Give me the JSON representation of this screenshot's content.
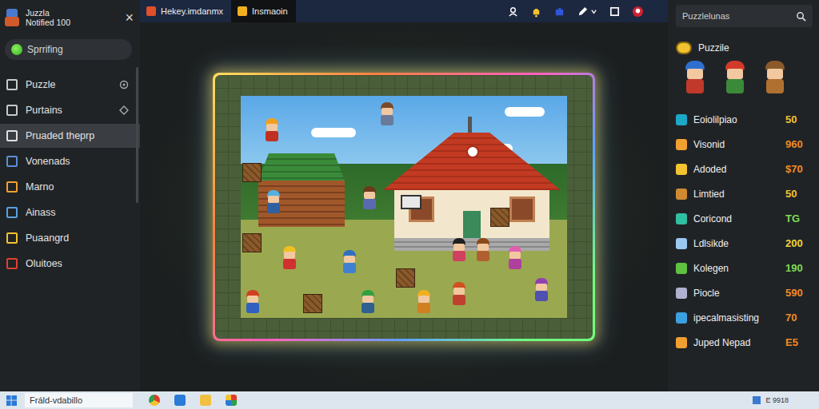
{
  "window": {
    "app_name": "Juzzla",
    "subtitle": "Notified 100",
    "close": "×"
  },
  "sidebar": {
    "search": "Sprrifing",
    "items": [
      {
        "label": "Puzzle",
        "selected": false
      },
      {
        "label": "Purtains",
        "selected": false
      },
      {
        "label": "Pruaded theprp",
        "selected": true
      },
      {
        "label": "Vonenads",
        "selected": false
      },
      {
        "label": "Marno",
        "selected": false
      },
      {
        "label": "Ainass",
        "selected": false
      },
      {
        "label": "Puaangrd",
        "selected": false
      },
      {
        "label": "Oluitoes",
        "selected": false
      }
    ]
  },
  "tabs": [
    {
      "label": "Hekey.imdanmx",
      "selected": false
    },
    {
      "label": "Insmaoin",
      "selected": true
    }
  ],
  "panel": {
    "search_placeholder": "Puzzlelunas",
    "heading": "Puzzile",
    "items": [
      {
        "label": "Eoiolilpiao",
        "value": "50",
        "color": "#f2c230"
      },
      {
        "label": "Visonid",
        "value": "960",
        "color": "#f08a24"
      },
      {
        "label": "Adoded",
        "value": "$70",
        "color": "#f08a24"
      },
      {
        "label": "Limtied",
        "value": "50",
        "color": "#f2c230"
      },
      {
        "label": "Coricond",
        "value": "TG",
        "color": "#7ed957"
      },
      {
        "label": "Ldlsikde",
        "value": "200",
        "color": "#f2d43a"
      },
      {
        "label": "Kolegen",
        "value": "190",
        "color": "#7ed957"
      },
      {
        "label": "Piocle",
        "value": "590",
        "color": "#f08a24"
      },
      {
        "label": "ipecalmasisting",
        "value": "70",
        "color": "#f08a24"
      },
      {
        "label": "Juped Nepad",
        "value": "E5",
        "color": "#f08a24"
      }
    ]
  },
  "taskbar": {
    "search": "Fráld-vdabillo",
    "tray": "E 9918"
  }
}
